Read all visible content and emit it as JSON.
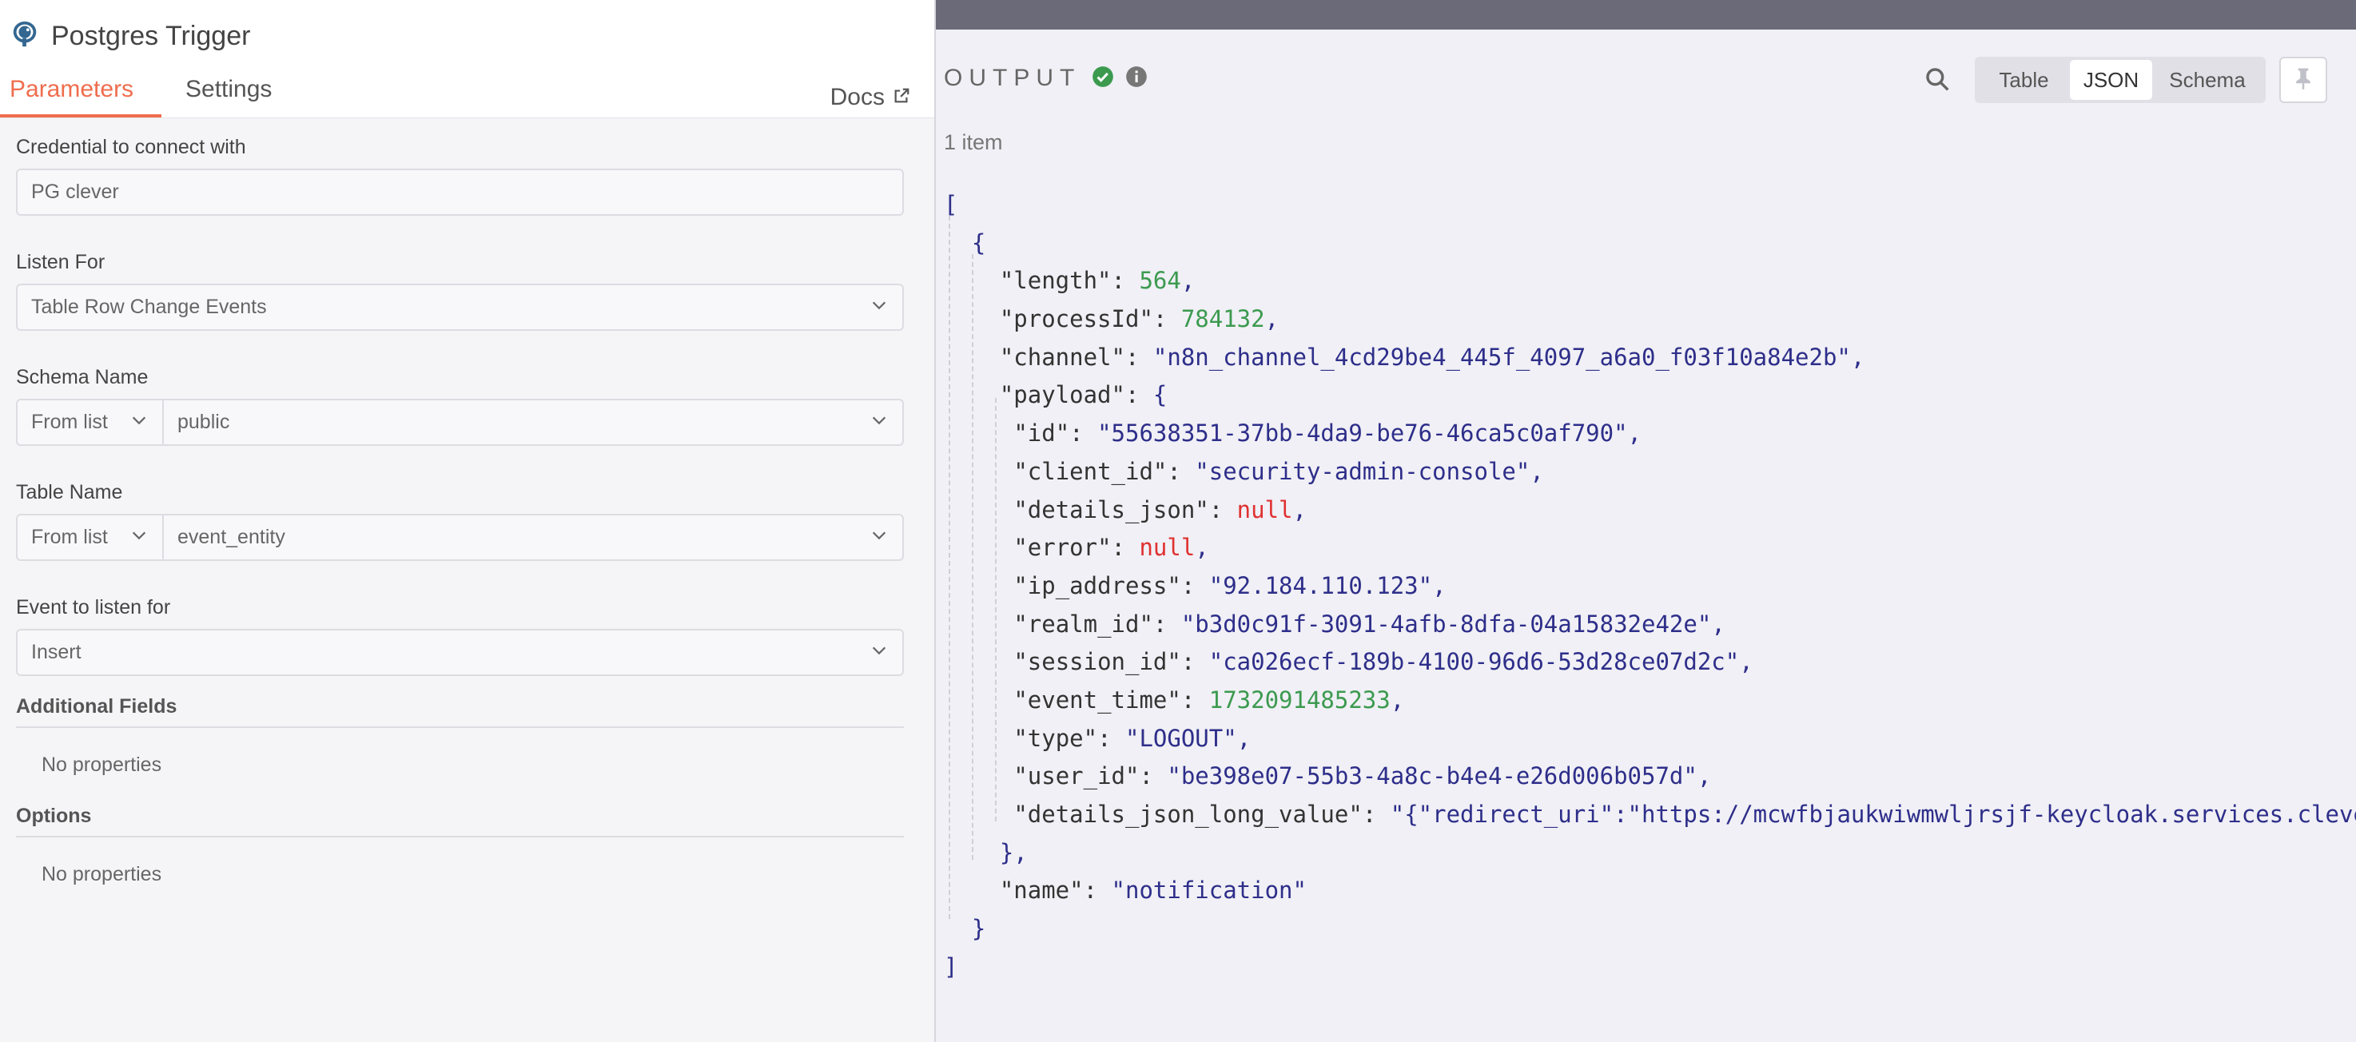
{
  "node": {
    "title": "Postgres Trigger",
    "icon": "postgres-elephant-icon"
  },
  "tabs": {
    "parameters": "Parameters",
    "settings": "Settings",
    "docs": "Docs"
  },
  "fields": {
    "credential": {
      "label": "Credential to connect with",
      "value": "PG clever"
    },
    "listen_for": {
      "label": "Listen For",
      "value": "Table Row Change Events"
    },
    "schema": {
      "label": "Schema Name",
      "mode": "From list",
      "value": "public"
    },
    "table": {
      "label": "Table Name",
      "mode": "From list",
      "value": "event_entity"
    },
    "event": {
      "label": "Event to listen for",
      "value": "Insert"
    }
  },
  "sections": {
    "additional": {
      "title": "Additional Fields",
      "empty": "No properties"
    },
    "options": {
      "title": "Options",
      "empty": "No properties"
    }
  },
  "output": {
    "title": "OUTPUT",
    "status_color": "#3c9a4f",
    "view_tabs": [
      "Table",
      "JSON",
      "Schema"
    ],
    "selected_view": "JSON",
    "item_count": "1 item"
  },
  "json_lines": [
    {
      "indent": 0,
      "open": "["
    },
    {
      "indent": 1,
      "open": "{"
    },
    {
      "indent": 2,
      "key": "\"length\"",
      "val": "564",
      "type": "num"
    },
    {
      "indent": 2,
      "key": "\"processId\"",
      "val": "784132",
      "type": "num"
    },
    {
      "indent": 2,
      "key": "\"channel\"",
      "val": "\"n8n_channel_4cd29be4_445f_4097_a6a0_f03f10a84e2b\"",
      "type": "str"
    },
    {
      "indent": 2,
      "key": "\"payload\"",
      "val": "{",
      "type": "open"
    },
    {
      "indent": 3,
      "key": "\"id\"",
      "val": "\"55638351-37bb-4da9-be76-46ca5c0af790\"",
      "type": "str"
    },
    {
      "indent": 3,
      "key": "\"client_id\"",
      "val": "\"security-admin-console\"",
      "type": "str"
    },
    {
      "indent": 3,
      "key": "\"details_json\"",
      "val": "null",
      "type": "nul"
    },
    {
      "indent": 3,
      "key": "\"error\"",
      "val": "null",
      "type": "nul"
    },
    {
      "indent": 3,
      "key": "\"ip_address\"",
      "val": "\"92.184.110.123\"",
      "type": "str"
    },
    {
      "indent": 3,
      "key": "\"realm_id\"",
      "val": "\"b3d0c91f-3091-4afb-8dfa-04a15832e42e\"",
      "type": "str"
    },
    {
      "indent": 3,
      "key": "\"session_id\"",
      "val": "\"ca026ecf-189b-4100-96d6-53d28ce07d2c\"",
      "type": "str"
    },
    {
      "indent": 3,
      "key": "\"event_time\"",
      "val": "1732091485233",
      "type": "num"
    },
    {
      "indent": 3,
      "key": "\"type\"",
      "val": "\"LOGOUT\"",
      "type": "str"
    },
    {
      "indent": 3,
      "key": "\"user_id\"",
      "val": "\"be398e07-55b3-4a8c-b4e4-e26d006b057d\"",
      "type": "str"
    },
    {
      "indent": 3,
      "key": "\"details_json_long_value\"",
      "val": "\"{\"redirect_uri\":\"https://mcwfbjaukwiwmwljrsjf-keycloak.services.clever-c",
      "type": "str",
      "last": true
    },
    {
      "indent": 2,
      "close": "},"
    },
    {
      "indent": 2,
      "key": "\"name\"",
      "val": "\"notification\"",
      "type": "str",
      "last": true
    },
    {
      "indent": 1,
      "close": "}"
    },
    {
      "indent": 0,
      "close": "]"
    }
  ]
}
